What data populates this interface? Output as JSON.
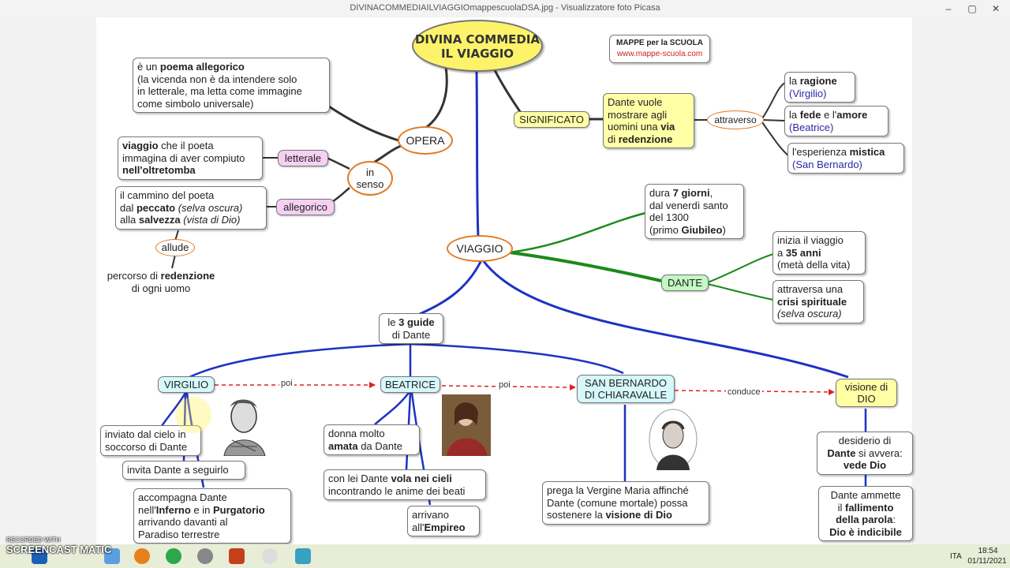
{
  "window": {
    "title": "DIVINACOMMEDIAILVIAGGIOmappescuolaDSA.jpg - Visualizzatore foto Picasa",
    "minimize": "–",
    "maximize": "▢",
    "close": "✕"
  },
  "map": {
    "title_line1": "DIVINA COMMEDIA",
    "title_line2": "IL VIAGGIO",
    "brand_line1": "MAPPE per la SCUOLA",
    "brand_line2": "www.mappe-scuola.com",
    "opera": "OPERA",
    "opera_desc": {
      "p1": "è un ",
      "b1": "poema allegorico",
      "l2": "(la vicenda non è da intendere solo",
      "l3": "in letterale, ma letta come immagine",
      "l4": "come simbolo universale)"
    },
    "in_senso_1": "in",
    "in_senso_2": "senso",
    "letterale": "letterale",
    "letterale_desc": {
      "b1": "viaggio",
      "p1": " che il poeta",
      "l2": "immagina di aver compiuto",
      "b3": "nell'oltretomba"
    },
    "allegorico": "allegorico",
    "allegorico_desc": {
      "l1": "il cammino del poeta",
      "p2": "dal ",
      "b2": "peccato",
      "i2": " (selva oscura)",
      "p3": "alla ",
      "b3": "salvezza",
      "i3": " (vista di Dio)"
    },
    "allude": "allude",
    "percorso": {
      "p1": "percorso di ",
      "b1": "redenzione",
      "l2": "di ogni uomo"
    },
    "significato": "SIGNIFICATO",
    "significato_desc": {
      "l1": "Dante vuole",
      "l2": "mostrare agli",
      "p3": "uomini una ",
      "b3": "via",
      "p4": "di ",
      "b4": "redenzione"
    },
    "attraverso": "attraverso",
    "ragione": {
      "p1": "la ",
      "b1": "ragione",
      "l2": "(Virgilio)"
    },
    "fede": {
      "p1": "la ",
      "b1": "fede",
      "p2": " e l'",
      "b2": "amore",
      "l2": "(Beatrice)"
    },
    "mistica": {
      "p1": "l'esperienza ",
      "b1": "mistica",
      "l2": "(San Bernardo)"
    },
    "viaggio": "VIAGGIO",
    "durata": {
      "p1": "dura ",
      "b1": "7 giorni",
      "p1b": ",",
      "l2": "dal venerdì santo",
      "l3": "del 1300",
      "p4": "(primo ",
      "b4": "Giubileo",
      "p4b": ")"
    },
    "dante": "DANTE",
    "inizia": {
      "l1": "inizia il viaggio",
      "p2": "a ",
      "b2": "35 anni",
      "l3": "(metà della vita)"
    },
    "crisi": {
      "l1": "attraversa una",
      "b2": "crisi spirituale",
      "i3": "(selva oscura)"
    },
    "guide": {
      "p1": "le ",
      "b1": "3 guide",
      "l2": "di Dante"
    },
    "virgilio": "VIRGILIO",
    "beatrice": "BEATRICE",
    "bernardo_1": "SAN BERNARDO",
    "bernardo_2": "DI CHIARAVALLE",
    "visione_1": "visione di",
    "visione_2": "DIO",
    "poi1": "poi",
    "poi2": "poi",
    "conduce": "conduce",
    "inviato": {
      "l1": "inviato dal cielo in",
      "l2": "soccorso di Dante"
    },
    "invita": "invita Dante a seguirlo",
    "accompagna": {
      "l1": "accompagna Dante",
      "p2": "nell'",
      "b2": "Inferno",
      "p2b": " e in ",
      "b2b": "Purgatorio",
      "l3": "arrivando davanti al",
      "l4": "Paradiso terrestre"
    },
    "donna": {
      "l1": "donna molto",
      "b2": "amata",
      "p2": " da Dante"
    },
    "con_lei": {
      "p1": "con lei Dante ",
      "b1": "vola nei cieli",
      "l2": "incontrando le anime dei beati"
    },
    "arrivano": {
      "l1": "arrivano",
      "p2": "all'",
      "b2": "Empireo"
    },
    "prega": {
      "l1": "prega la Vergine Maria affinché",
      "l2": "Dante (comune mortale) possa",
      "p3": "sostenere la ",
      "b3": "visione di Dio"
    },
    "desiderio": {
      "l1": "desiderio di",
      "b2": "Dante",
      "p2": " si avvera:",
      "b3": "vede Dio"
    },
    "ammette": {
      "l1": "Dante ammette",
      "p2": "il ",
      "b2": "fallimento",
      "b3": "della parola",
      "p3": ":",
      "b4": "Dio è indicibile"
    }
  },
  "watermark": {
    "l1": "RECORDED WITH",
    "l2": "SCREENCAST",
    "l3": "MATIC"
  },
  "taskbar": {
    "lang": "ITA",
    "time": "18:54",
    "date": "01/11/2021"
  },
  "colors": {
    "orange": "#e07a26",
    "blue_line": "#1d33c2",
    "green_line": "#1a8a1a",
    "dark_line": "#333333",
    "red_dash": "#e02020"
  }
}
